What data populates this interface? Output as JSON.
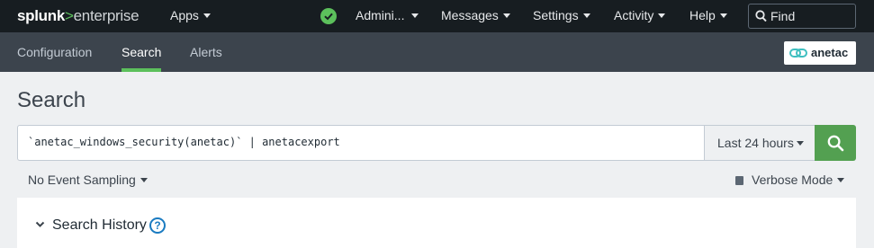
{
  "topbar": {
    "logo": {
      "part1": "splunk",
      "arrow": ">",
      "part2": "enterprise"
    },
    "apps_label": "Apps",
    "user_label": "Admini...",
    "messages_label": "Messages",
    "settings_label": "Settings",
    "activity_label": "Activity",
    "help_label": "Help",
    "find_placeholder": "Find",
    "status_color": "#5cc05c"
  },
  "appbar": {
    "tabs": [
      {
        "label": "Configuration",
        "active": false
      },
      {
        "label": "Search",
        "active": true
      },
      {
        "label": "Alerts",
        "active": false
      }
    ],
    "app_logo_text": "anetac",
    "accent": "#5cc05c"
  },
  "main": {
    "title": "Search",
    "query": "`anetac_windows_security(anetac)` | anetacexport",
    "time_range": "Last 24 hours",
    "search_button_icon": "search-icon",
    "search_button_color": "#53a051",
    "sampling_label": "No Event Sampling",
    "mode_label": "Verbose Mode",
    "history": {
      "title": "Search History",
      "help_glyph": "?"
    }
  }
}
